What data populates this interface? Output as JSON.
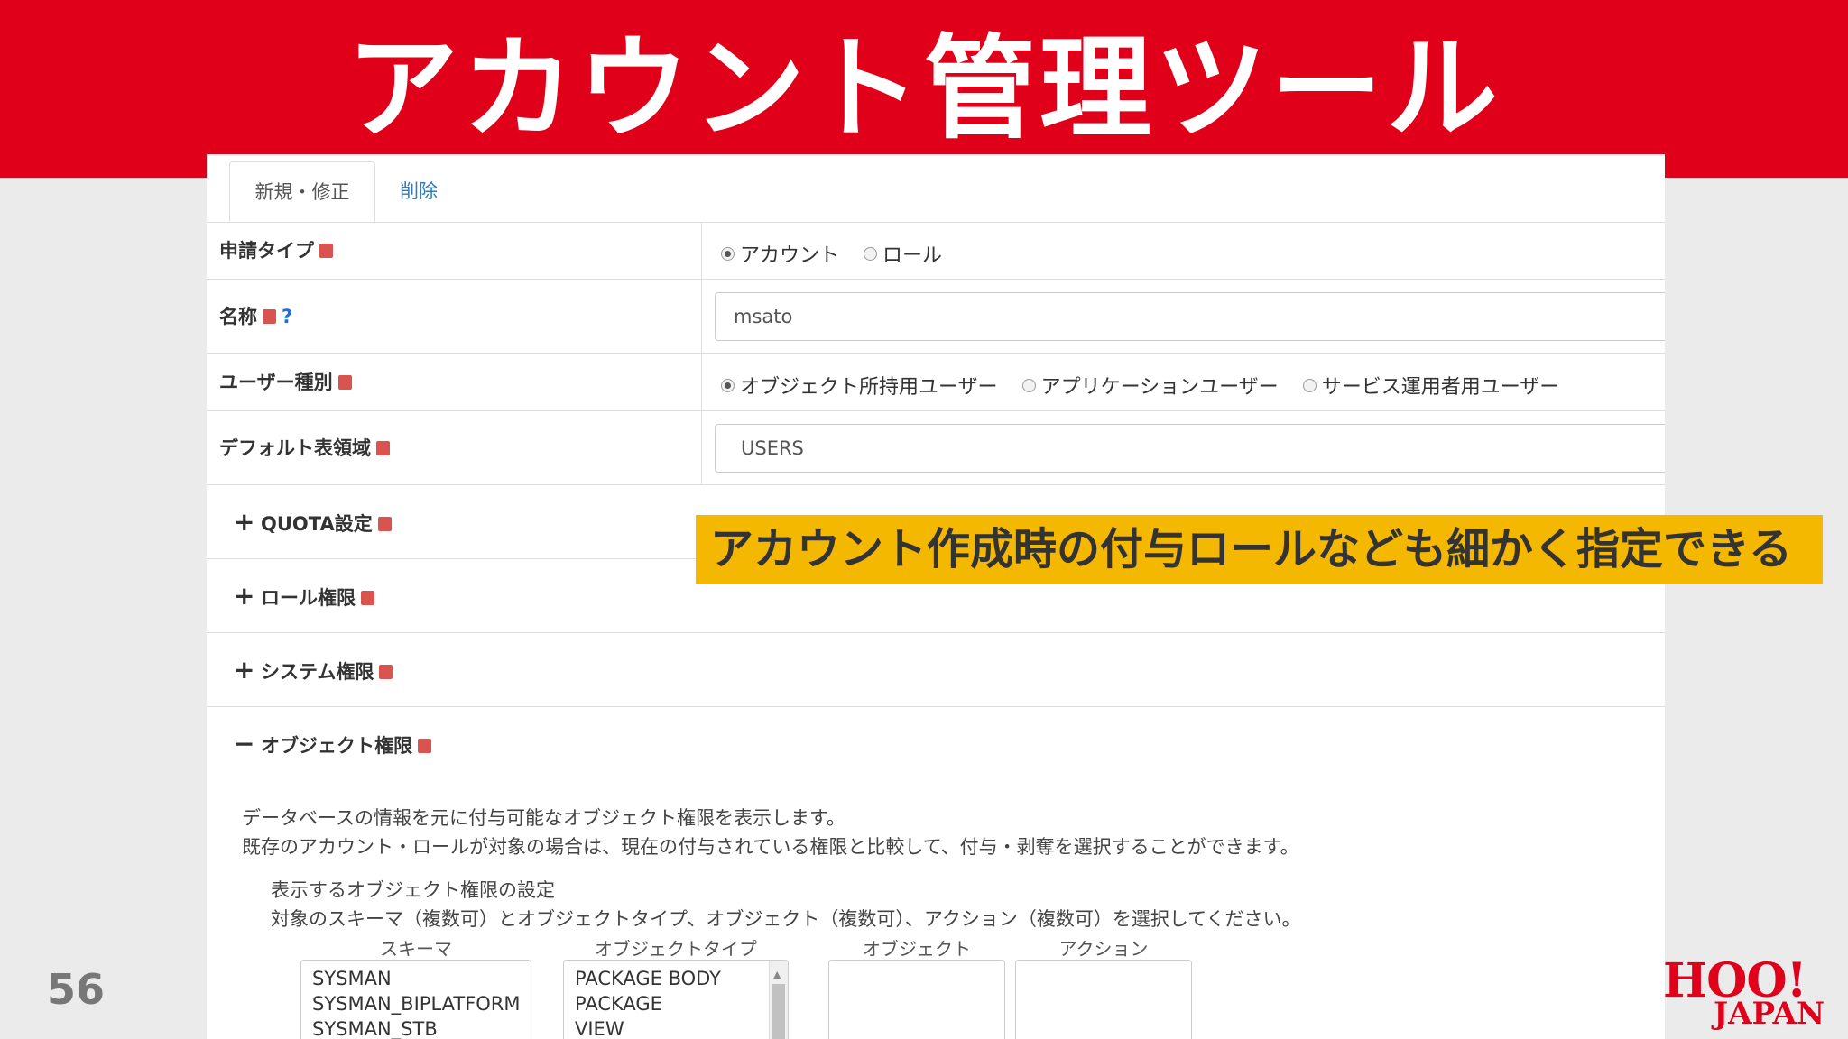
{
  "slide": {
    "title": "アカウント管理ツール",
    "page_number": "56"
  },
  "tabs": [
    {
      "label": "新規・修正",
      "active": true
    },
    {
      "label": "削除",
      "active": false
    }
  ],
  "form": {
    "request_type": {
      "label": "申請タイプ",
      "options": [
        {
          "label": "アカウント",
          "checked": true
        },
        {
          "label": "ロール",
          "checked": false
        }
      ]
    },
    "name": {
      "label": "名称",
      "help": "?",
      "value": "msato"
    },
    "user_type": {
      "label": "ユーザー種別",
      "options": [
        {
          "label": "オブジェクト所持用ユーザー",
          "checked": true
        },
        {
          "label": "アプリケーションユーザー",
          "checked": false
        },
        {
          "label": "サービス運用者用ユーザー",
          "checked": false
        }
      ]
    },
    "default_tablespace": {
      "label": "デフォルト表領域",
      "value": "USERS"
    }
  },
  "sections": {
    "quota": {
      "label": "QUOTA設定",
      "toggle": "+"
    },
    "role": {
      "label": "ロール権限",
      "toggle": "+"
    },
    "system": {
      "label": "システム権限",
      "toggle": "+"
    },
    "object": {
      "label": "オブジェクト権限",
      "toggle": "−"
    }
  },
  "object_privilege": {
    "desc1": "データベースの情報を元に付与可能なオブジェクト権限を表示します。",
    "desc2": "既存のアカウント・ロールが対象の場合は、現在の付与されている権限と比較して、付与・剥奪を選択することができます。",
    "settings_title": "表示するオブジェクト権限の設定",
    "settings_desc": "対象のスキーマ（複数可）とオブジェクトタイプ、オブジェクト（複数可）、アクション（複数可）を選択してください。",
    "columns": {
      "schema": "スキーマ",
      "object_type": "オブジェクトタイプ",
      "object": "オブジェクト",
      "action": "アクション"
    },
    "schema_items": [
      "SYSMAN",
      "SYSMAN_BIPLATFORM",
      "SYSMAN_STB"
    ],
    "object_type_items": [
      "PACKAGE BODY",
      "PACKAGE",
      "VIEW"
    ]
  },
  "callout": {
    "text": "アカウント作成時の付与ロールなども細かく指定できる",
    "color": "#f5b800"
  },
  "brand": {
    "logo_main": "HOO!",
    "logo_sub": "JAPAN",
    "color": "#e0001a"
  }
}
